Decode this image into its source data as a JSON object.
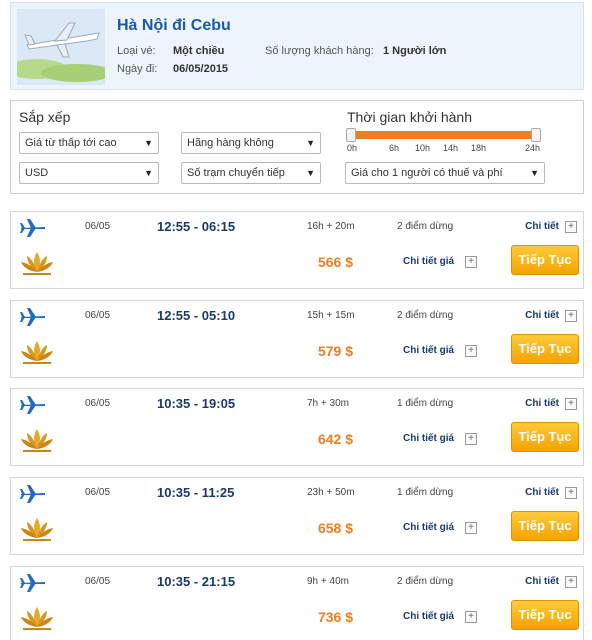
{
  "header": {
    "title": "Hà Nội đi Cebu",
    "ticket_type_label": "Loại vé:",
    "ticket_type_value": "Một chiều",
    "date_label": "Ngày đi:",
    "date_value": "06/05/2015",
    "passengers_label": "Số lượng khách hàng:",
    "passengers_value": "1 Người lớn"
  },
  "filter": {
    "sort_title": "Sắp xếp",
    "sort_select": "Giá từ thấp tới cao",
    "airline_select": "Hãng hàng không",
    "currency_select": "USD",
    "stops_select": "Số trạm chuyển tiếp",
    "departure_title": "Thời gian khởi hành",
    "price_select": "Giá cho 1 người có thuế và phí",
    "ticks": [
      "0h",
      "6h",
      "10h",
      "14h",
      "18h",
      "24h"
    ]
  },
  "flights": [
    {
      "date": "06/05",
      "time": "12:55 - 06:15",
      "duration": "16h + 20m",
      "stops": "2 điểm dừng",
      "detail": "Chi tiết",
      "price": "566 $",
      "price_detail": "Chi tiết giá",
      "button": "Tiếp Tục"
    },
    {
      "date": "06/05",
      "time": "12:55 - 05:10",
      "duration": "15h + 15m",
      "stops": "2 điểm dừng",
      "detail": "Chi tiết",
      "price": "579 $",
      "price_detail": "Chi tiết giá",
      "button": "Tiếp Tục"
    },
    {
      "date": "06/05",
      "time": "10:35 - 19:05",
      "duration": "7h + 30m",
      "stops": "1 điểm dừng",
      "detail": "Chi tiết",
      "price": "642 $",
      "price_detail": "Chi tiết giá",
      "button": "Tiếp Tục"
    },
    {
      "date": "06/05",
      "time": "10:35 - 11:25",
      "duration": "23h + 50m",
      "stops": "1 điểm dừng",
      "detail": "Chi tiết",
      "price": "658 $",
      "price_detail": "Chi tiết giá",
      "button": "Tiếp Tục"
    },
    {
      "date": "06/05",
      "time": "10:35 - 21:15",
      "duration": "9h + 40m",
      "stops": "2 điểm dừng",
      "detail": "Chi tiết",
      "price": "736 $",
      "price_detail": "Chi tiết giá",
      "button": "Tiếp Tục"
    }
  ],
  "icons": {
    "header_image": "airplane-photo-icon",
    "flight_type": "airplane-icon",
    "airline_logo": "lotus-icon",
    "expand": "plus-icon",
    "dropdown": "chevron-down-icon"
  },
  "colors": {
    "accent": "#f07d1f",
    "link": "#1a3a6b",
    "title": "#1a5aa7",
    "button": "#f5a300"
  }
}
